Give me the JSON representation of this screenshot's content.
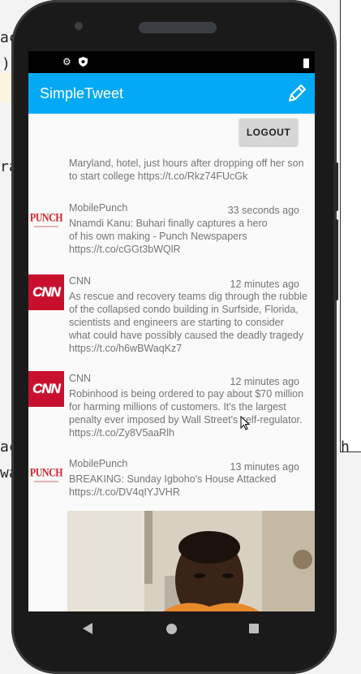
{
  "background": {
    "code_lines": [
      {
        "text": "ac"
      },
      {
        "text": ")"
      },
      {
        "text": "ra"
      },
      {
        "text": "ac"
      },
      {
        "text": "wa"
      },
      {
        "text": "h"
      }
    ]
  },
  "statusbar": {
    "icons": [
      "gear-icon",
      "shield-icon",
      "battery-icon"
    ]
  },
  "appbar": {
    "title": "SimpleTweet",
    "compose_icon": "pencil-icon",
    "color": "#03a9f4"
  },
  "logout_label": "LOGOUT",
  "tweets": [
    {
      "text": "Maryland, hotel, just hours after dropping off her son\nto start college https://t.co/Rkz74FUcGk"
    },
    {
      "name": "MobilePunch",
      "time": "33 seconds ago",
      "avatar": "PUNCH",
      "text": "Nnamdi Kanu: Buhari finally captures a hero\nof his own making - Punch Newspapers\nhttps://t.co/cGGt3bWQlR"
    },
    {
      "name": "CNN",
      "time": "12 minutes ago",
      "avatar": "CNN",
      "text": "As rescue and recovery teams dig through the rubble\nof the collapsed condo building in Surfside, Florida,\nscientists and engineers are starting to consider\nwhat could have possibly caused the deadly tragedy\nhttps://t.co/h6wBWaqKz7"
    },
    {
      "name": "CNN",
      "time": "12 minutes ago",
      "avatar": "CNN",
      "text": "Robinhood is being ordered to pay about $70 million\nfor harming millions of customers. It's the largest\npenalty ever imposed by Wall Street's self-regulator.\nhttps://t.co/Zy8V5aaRlh"
    },
    {
      "name": "MobilePunch",
      "time": "13 minutes ago",
      "avatar": "PUNCH",
      "text": "BREAKING: Sunday Igboho's House Attacked\nhttps://t.co/DV4qIYJVHR"
    }
  ],
  "navbar": {
    "icons": [
      "back-icon",
      "home-icon",
      "recent-apps-icon"
    ]
  }
}
